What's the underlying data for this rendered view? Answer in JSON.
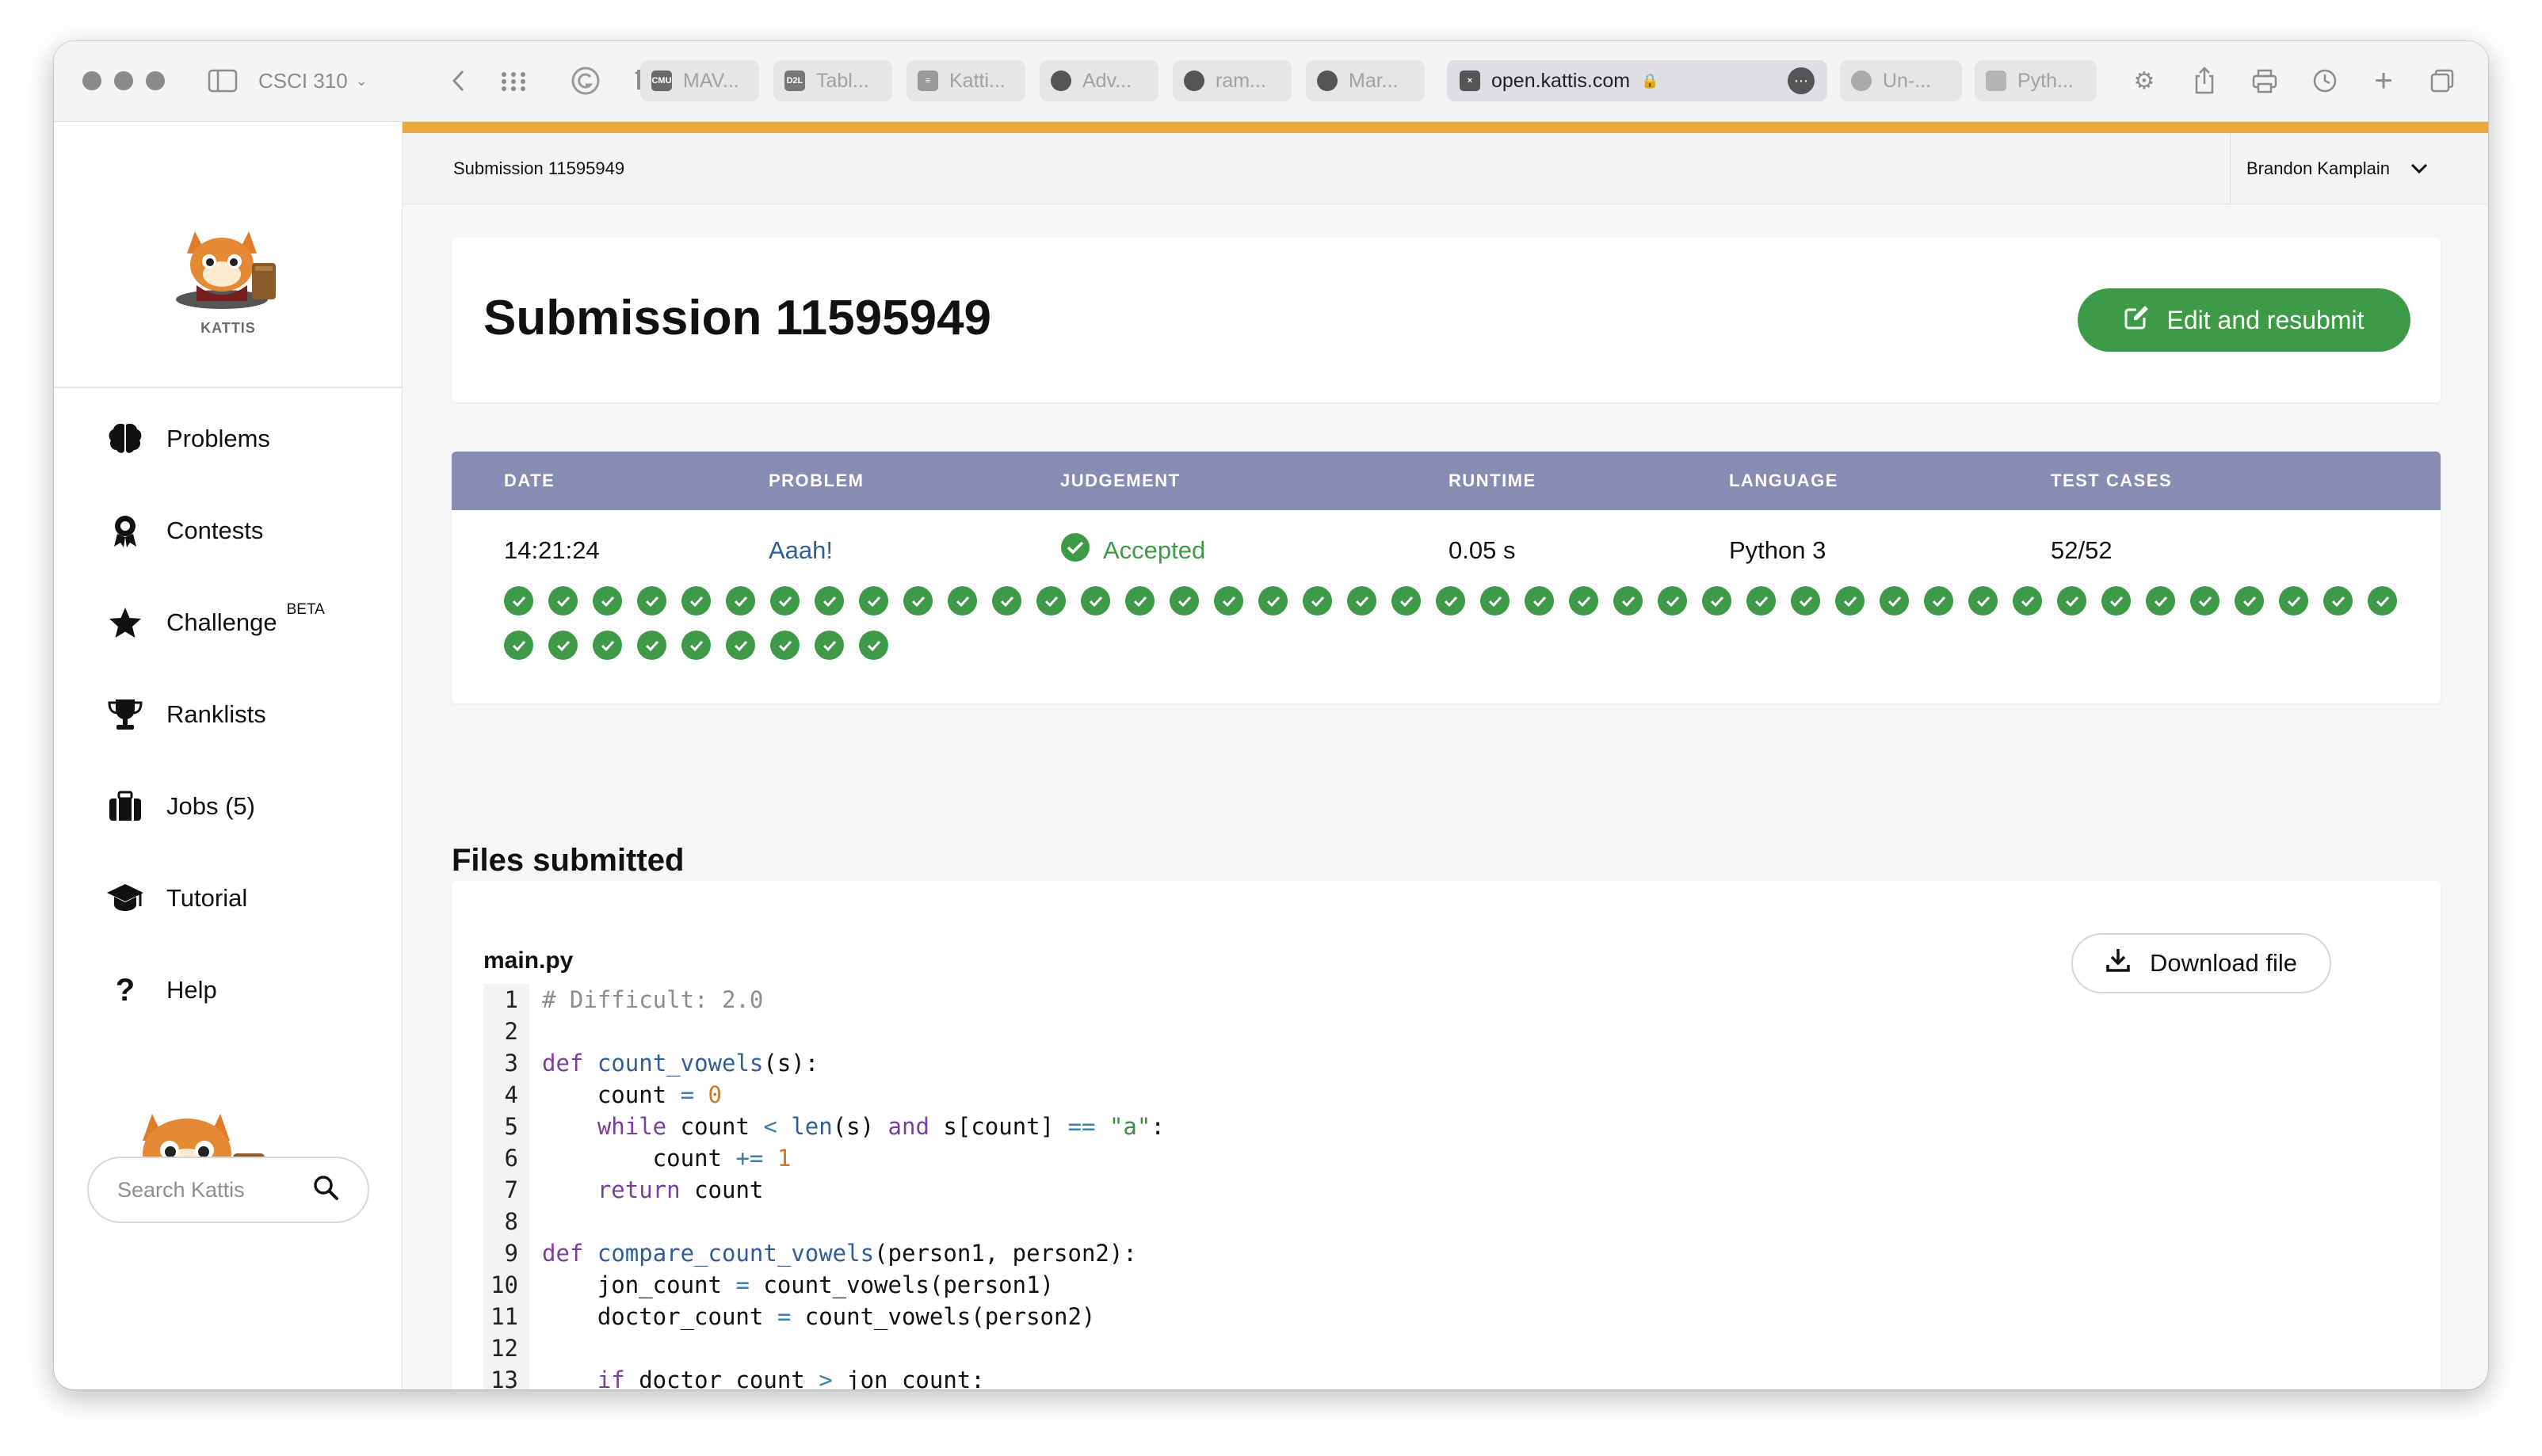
{
  "browser": {
    "sidebar_group": "CSCI 310",
    "url": "open.kattis.com",
    "tabs": [
      "MAV...",
      "Tabl...",
      "Katti...",
      "Adv...",
      "ram...",
      "Mar...",
      "Un-...",
      "Pyth..."
    ]
  },
  "topbar": {
    "breadcrumb": "Submission 11595949",
    "user": "Brandon Kamplain"
  },
  "sidebar": {
    "logo_caption": "KATTIS",
    "items": [
      {
        "label": "Problems",
        "icon": "brain-icon"
      },
      {
        "label": "Contests",
        "icon": "award-icon"
      },
      {
        "label": "Challenge",
        "icon": "star-icon",
        "badge": "BETA"
      },
      {
        "label": "Ranklists",
        "icon": "trophy-icon"
      },
      {
        "label": "Jobs (5)",
        "icon": "briefcase-icon"
      },
      {
        "label": "Tutorial",
        "icon": "graduation-cap-icon"
      },
      {
        "label": "Help",
        "icon": "question-icon"
      }
    ],
    "search_placeholder": "Search Kattis"
  },
  "submission": {
    "title": "Submission 11595949",
    "edit_button": "Edit and resubmit",
    "headers": [
      "DATE",
      "PROBLEM",
      "JUDGEMENT",
      "RUNTIME",
      "LANGUAGE",
      "TEST CASES"
    ],
    "date": "14:21:24",
    "problem": "Aaah!",
    "judgement": "Accepted",
    "runtime": "0.05 s",
    "language": "Python 3",
    "test_cases": "52/52",
    "tests_passed": 52,
    "tests_total": 52
  },
  "files": {
    "section_title": "Files submitted",
    "file_name": "main.py",
    "download_button": "Download file",
    "line_numbers": [
      "1",
      "2",
      "3",
      "4",
      "5",
      "6",
      "7",
      "8",
      "9",
      "10",
      "11",
      "12",
      "13"
    ]
  },
  "colors": {
    "accent": "#e6a93b",
    "success": "#3f9a47",
    "table_header": "#878db2",
    "link": "#2f5e98"
  }
}
